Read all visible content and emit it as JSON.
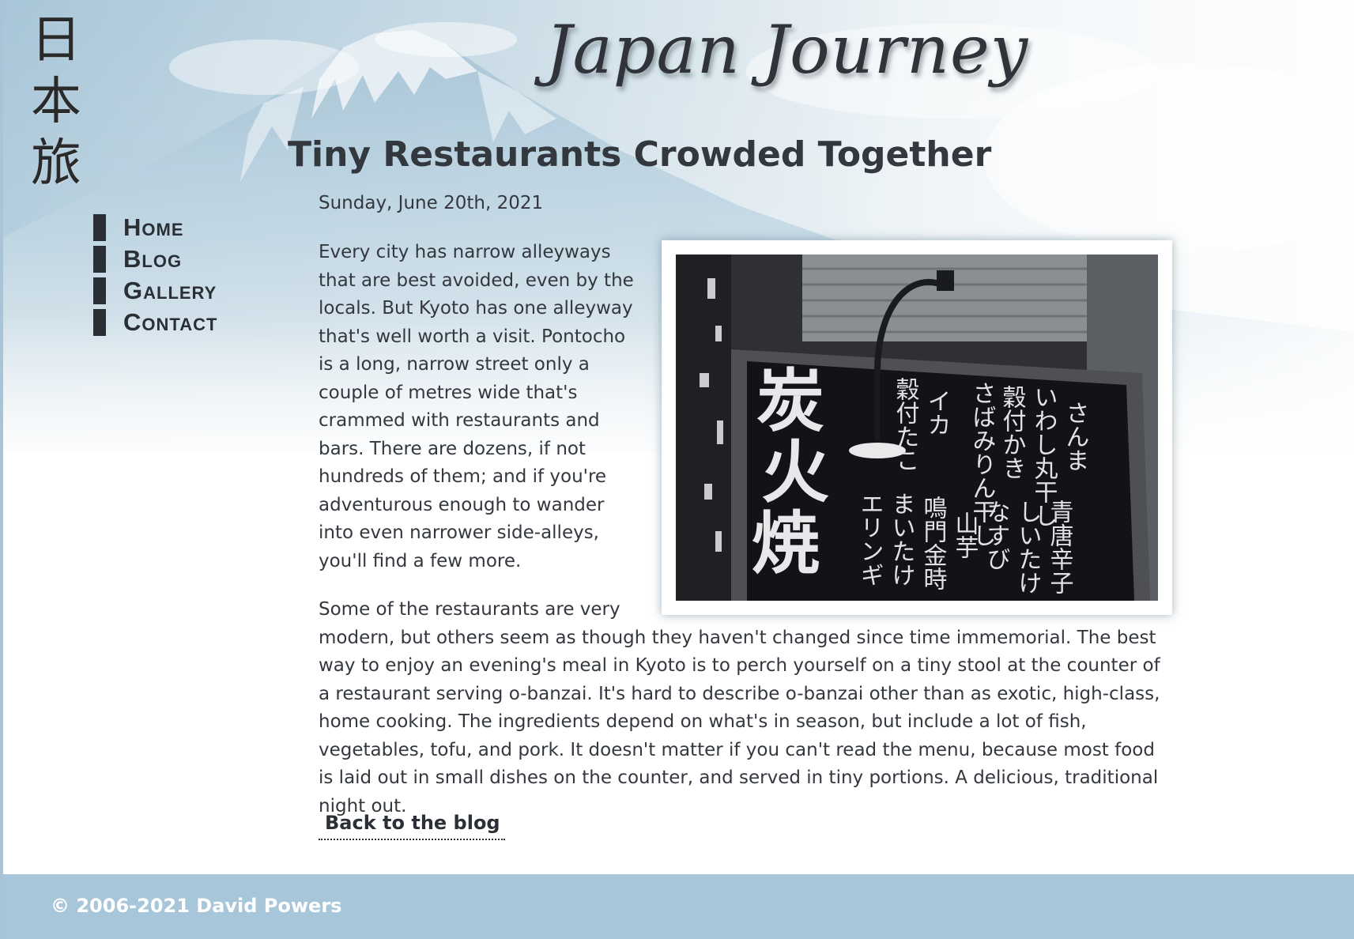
{
  "header": {
    "logo_kanji": [
      "日",
      "本",
      "旅"
    ],
    "site_title": "Japan Journey"
  },
  "nav": {
    "items": [
      {
        "label": "Home"
      },
      {
        "label": "Blog"
      },
      {
        "label": "Gallery"
      },
      {
        "label": "Contact"
      }
    ]
  },
  "post": {
    "title": "Tiny Restaurants Crowded Together",
    "date": "Sunday, June 20th, 2021",
    "paragraphs": [
      "Every city has narrow alleyways that are best avoided, even by the locals. But Kyoto has one alleyway that's well worth a visit. Pontocho is a long, narrow street only a couple of metres wide that's crammed with restaurants and bars. There are dozens, if not hundreds of them; and if you're adventurous enough to wander into even narrower side-alleys, you'll find a few more.",
      "Some of the restaurants are very modern, but others seem as though they haven't changed since time immemorial. The best way to enjoy an evening's meal in Kyoto is to perch yourself on a tiny stool at the counter of a restaurant serving o-banzai. It's hard to describe o-banzai other than as exotic, high-class, home cooking. The ingredients depend on what's in season, but include a lot of fish, vegetables, tofu, and pork. It doesn't matter if you can't read the menu, because most food is laid out in small dishes on the counter, and served in tiny portions. A delicious, traditional night out."
    ],
    "photo": {
      "sign_big": [
        "炭",
        "火",
        "焼"
      ],
      "sign_cols": [
        "さんま",
        "いわし丸干し",
        "穀付かき",
        "さばみりん干し",
        "イカ",
        "穀付たこ"
      ],
      "sign_lower_cols": [
        "青唐辛子",
        "しいたけ",
        "なすび",
        "山芋",
        "鳴門金時",
        "まいたけ",
        "エリンギ"
      ]
    },
    "back_link": "Back to the blog"
  },
  "footer": {
    "copyright": "© 2006-2021 David Powers"
  },
  "colors": {
    "footer_bg": "#a7c6da",
    "text": "#33373e",
    "nav_bar": "#2a2f36"
  }
}
